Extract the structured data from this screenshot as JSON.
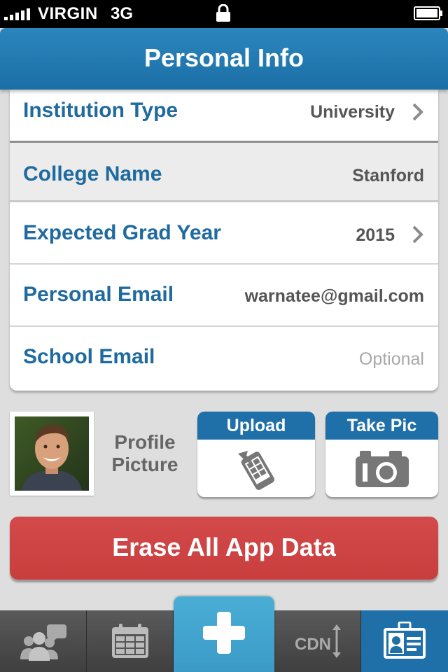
{
  "status_bar": {
    "carrier": "VIRGIN",
    "network": "3G",
    "icons": [
      "signal-bars-icon",
      "lock-icon",
      "battery-icon"
    ]
  },
  "nav": {
    "title": "Personal Info"
  },
  "form": {
    "rows": [
      {
        "label": "Institution Type",
        "value": "University",
        "has_chevron": true
      },
      {
        "label": "College Name",
        "value": "Stanford",
        "has_chevron": false
      },
      {
        "label": "Expected Grad Year",
        "value": "2015",
        "has_chevron": true
      },
      {
        "label": "Personal Email",
        "value": "warnatee@gmail.com",
        "has_chevron": false
      },
      {
        "label": "School Email",
        "placeholder": "Optional",
        "has_chevron": false
      }
    ]
  },
  "profile": {
    "label": "Profile Picture",
    "upload_label": "Upload",
    "take_pic_label": "Take Pic"
  },
  "erase_label": "Erase All App Data",
  "tab_bar": {
    "tabs": [
      "people-icon",
      "calendar-icon",
      "add-icon",
      "cdn-icon",
      "id-card-icon"
    ],
    "cdn_text": "CDN",
    "active_tab": "id-card-icon"
  },
  "colors": {
    "primary_blue": "#1f6fa8",
    "label_blue": "#1f6a9e",
    "danger_red": "#c93d3d",
    "add_tab_blue": "#3b9bc6",
    "tab_bar_gray": "#4a4a4a"
  }
}
